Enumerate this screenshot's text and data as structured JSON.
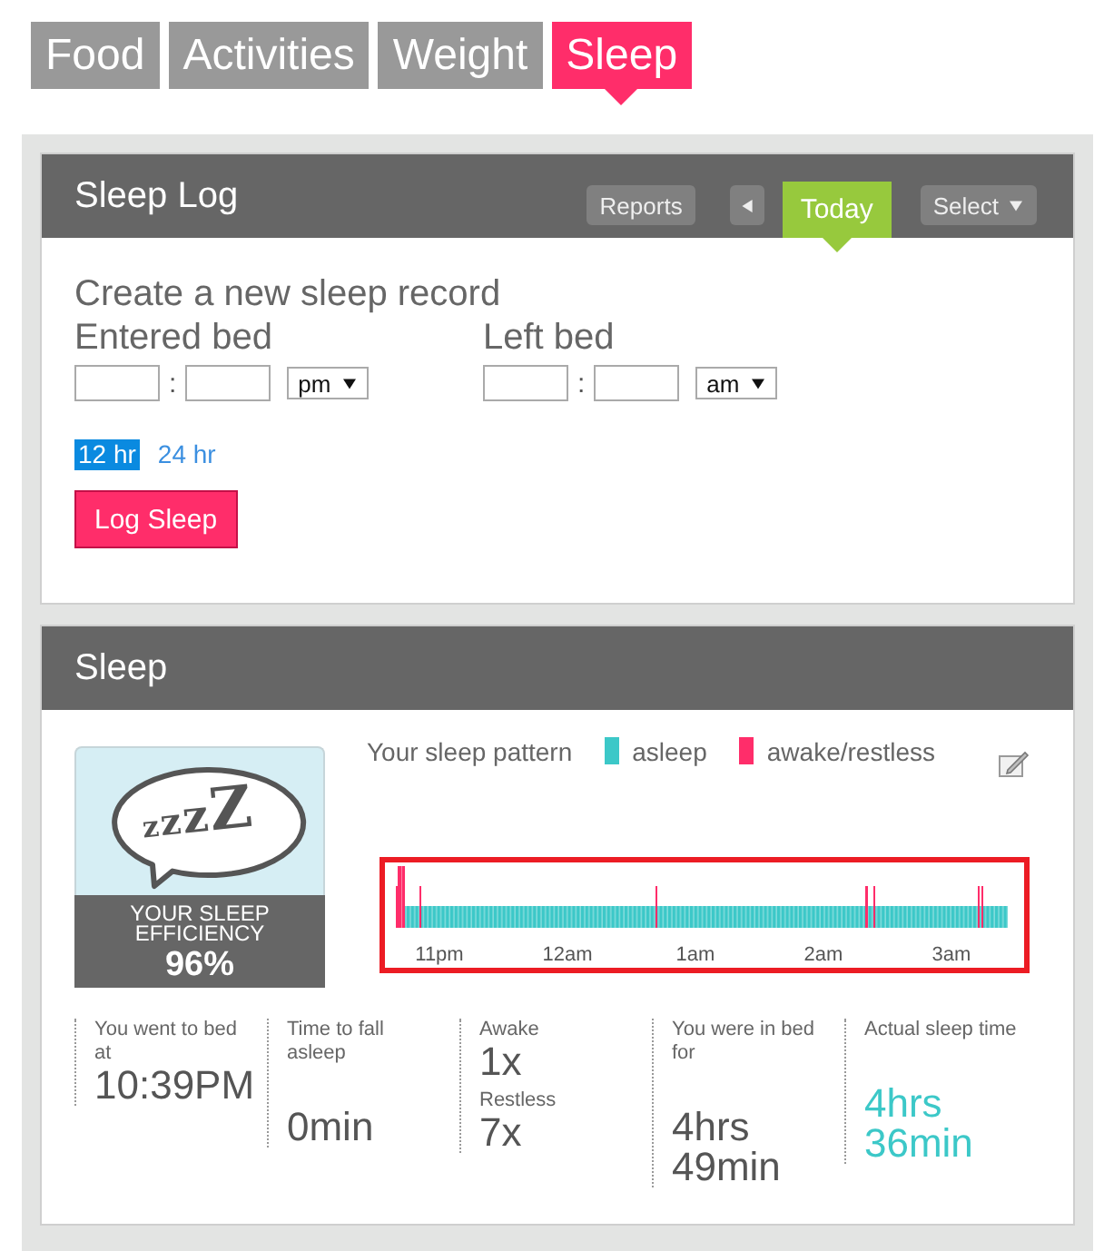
{
  "nav_tabs": [
    {
      "label": "Food",
      "selected": false
    },
    {
      "label": "Activities",
      "selected": false
    },
    {
      "label": "Weight",
      "selected": false
    },
    {
      "label": "Sleep",
      "selected": true
    }
  ],
  "sleep_log": {
    "title": "Sleep Log",
    "header_controls": [
      {
        "kind": "button",
        "label": "Reports"
      },
      {
        "kind": "previous"
      },
      {
        "kind": "current",
        "label": "Today"
      },
      {
        "kind": "dropdown",
        "label": "Select"
      }
    ],
    "form_title": "Create a new sleep record",
    "time_groups": [
      {
        "label": "Entered bed",
        "separator": ":",
        "period": "pm"
      },
      {
        "label": "Left bed",
        "separator": ":",
        "period": "am"
      }
    ],
    "time_formats": [
      {
        "label": "12 hr",
        "selected": true
      },
      {
        "label": "24 hr",
        "selected": false
      }
    ],
    "submit_button": "Log Sleep"
  },
  "sleep": {
    "title": "Sleep",
    "efficiency": {
      "art_text": "zzzZ",
      "label": "YOUR SLEEP EFFICIENCY",
      "value": "96%"
    },
    "pattern": {
      "title": "Your sleep pattern",
      "legend": [
        {
          "label": "asleep",
          "color": "#3cc8c8"
        },
        {
          "label": "awake/restless",
          "color": "#ff2d6a"
        }
      ],
      "time_labels": [
        "11pm",
        "12am",
        "1am",
        "2am",
        "3am"
      ]
    },
    "stats": [
      {
        "kind": "inline",
        "highlighted": false,
        "entries": [
          {
            "label": "You went to bed at",
            "value": "10:39PM"
          }
        ]
      },
      {
        "kind": "aligned",
        "highlighted": false,
        "entries": [
          {
            "label": "Time to fall asleep",
            "value": "0min"
          }
        ]
      },
      {
        "kind": "inline",
        "highlighted": false,
        "entries": [
          {
            "label": "Awake",
            "value": "1x"
          },
          {
            "label": "Restless",
            "value": "7x"
          }
        ]
      },
      {
        "kind": "aligned",
        "highlighted": false,
        "entries": [
          {
            "label": "You were in bed for",
            "value": "4hrs 49min"
          }
        ]
      },
      {
        "kind": "aligned",
        "highlighted": true,
        "entries": [
          {
            "label": "Actual sleep time",
            "value": "4hrs 36min"
          }
        ]
      }
    ]
  }
}
